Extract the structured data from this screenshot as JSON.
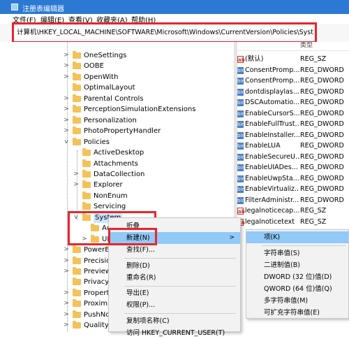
{
  "window": {
    "title": "注册表编辑器"
  },
  "menu": [
    "文件(F)",
    "编辑(E)",
    "查看(V)",
    "收藏夹(A)",
    "帮助(H)"
  ],
  "address": {
    "path": "计算机\\HKEY_LOCAL_MACHINE\\SOFTWARE\\Microsoft\\Windows\\CurrentVersion\\Policies\\System"
  },
  "tree": [
    {
      "label": "OneSettings",
      "level": 1,
      "expand": ">"
    },
    {
      "label": "OOBE",
      "level": 1,
      "expand": ">"
    },
    {
      "label": "OpenWith",
      "level": 1,
      "expand": ">"
    },
    {
      "label": "OptimalLayout",
      "level": 1,
      "expand": ""
    },
    {
      "label": "Parental Controls",
      "level": 1,
      "expand": ">"
    },
    {
      "label": "PerceptionSimulationExtensions",
      "level": 1,
      "expand": ">"
    },
    {
      "label": "Personalization",
      "level": 1,
      "expand": ">"
    },
    {
      "label": "PhotoPropertyHandler",
      "level": 1,
      "expand": ">"
    },
    {
      "label": "Policies",
      "level": 1,
      "expand": "v"
    },
    {
      "label": "ActiveDesktop",
      "level": 2,
      "expand": ""
    },
    {
      "label": "Attachments",
      "level": 2,
      "expand": ""
    },
    {
      "label": "DataCollection",
      "level": 2,
      "expand": ">"
    },
    {
      "label": "Explorer",
      "level": 2,
      "expand": ">"
    },
    {
      "label": "NonEnum",
      "level": 2,
      "expand": ""
    },
    {
      "label": "Servicing",
      "level": 2,
      "expand": ""
    },
    {
      "label": "System",
      "level": 2,
      "expand": "v",
      "selected": true
    },
    {
      "label": "Au",
      "level": 3,
      "expand": ""
    },
    {
      "label": "UI",
      "level": 3,
      "expand": ">"
    },
    {
      "label": "PowerEf",
      "level": 1,
      "expand": ">"
    },
    {
      "label": "Precisio",
      "level": 1,
      "expand": ">"
    },
    {
      "label": "Preview",
      "level": 1,
      "expand": ">"
    },
    {
      "label": "Privacy",
      "level": 1,
      "expand": ""
    },
    {
      "label": "Property",
      "level": 1,
      "expand": ">"
    },
    {
      "label": "Proximit",
      "level": 1,
      "expand": ">"
    },
    {
      "label": "PushNo",
      "level": 1,
      "expand": ">"
    },
    {
      "label": "QualityC",
      "level": 1,
      "expand": ">"
    }
  ],
  "values_header": {
    "type": "类型"
  },
  "values": [
    {
      "icon": "ab",
      "name": "(默认)",
      "type": "REG_SZ"
    },
    {
      "icon": "bin",
      "name": "ConsentPromp...",
      "type": "REG_DWORD"
    },
    {
      "icon": "bin",
      "name": "ConsentPromp...",
      "type": "REG_DWORD"
    },
    {
      "icon": "bin",
      "name": "dontdisplaylas...",
      "type": "REG_DWORD"
    },
    {
      "icon": "bin",
      "name": "DSCAutomatio...",
      "type": "REG_DWORD"
    },
    {
      "icon": "bin",
      "name": "EnableCursorS...",
      "type": "REG_DWORD"
    },
    {
      "icon": "bin",
      "name": "EnableFullTrust...",
      "type": "REG_DWORD"
    },
    {
      "icon": "bin",
      "name": "EnableInstaller...",
      "type": "REG_DWORD"
    },
    {
      "icon": "bin",
      "name": "EnableLUA",
      "type": "REG_DWORD"
    },
    {
      "icon": "bin",
      "name": "EnableSecureU...",
      "type": "REG_DWORD"
    },
    {
      "icon": "bin",
      "name": "EnableUIADes...",
      "type": "REG_DWORD"
    },
    {
      "icon": "bin",
      "name": "EnableUwpSta...",
      "type": "REG_DWORD"
    },
    {
      "icon": "bin",
      "name": "EnableVirtualiz...",
      "type": "REG_DWORD"
    },
    {
      "icon": "bin",
      "name": "FilterAdministr...",
      "type": "REG_DWORD"
    },
    {
      "icon": "ab",
      "name": "legalnoticecap...",
      "type": "REG_SZ"
    },
    {
      "icon": "ab",
      "name": "legalnoticetext",
      "type": "REG_SZ"
    }
  ],
  "context_menu": {
    "items": [
      "折叠",
      "新建(N)",
      "查找(F)...",
      "删除(D)",
      "重命名(R)",
      "导出(E)",
      "权限(P)...",
      "复制项名称(C)",
      "访问 HKEY_CURRENT_USER(T)"
    ],
    "submenu_arrow": ">"
  },
  "submenu": {
    "items": [
      "项(K)",
      "字符串值(S)",
      "二进制值(B)",
      "DWORD (32 位)值(D)",
      "QWORD (64 位)值(Q)",
      "多字符串值(M)",
      "可扩充字符串值(E)"
    ]
  }
}
